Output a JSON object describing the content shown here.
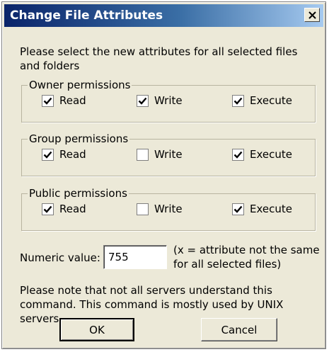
{
  "window": {
    "title": "Change File Attributes",
    "close_glyph": "✕"
  },
  "intro_text": "Please select the new attributes for all selected files and folders",
  "groups": [
    {
      "legend": "Owner permissions",
      "options": [
        {
          "label": "Read",
          "checked": true
        },
        {
          "label": "Write",
          "checked": true
        },
        {
          "label": "Execute",
          "checked": true
        }
      ]
    },
    {
      "legend": "Group permissions",
      "options": [
        {
          "label": "Read",
          "checked": true
        },
        {
          "label": "Write",
          "checked": false
        },
        {
          "label": "Execute",
          "checked": true
        }
      ]
    },
    {
      "legend": "Public permissions",
      "options": [
        {
          "label": "Read",
          "checked": true
        },
        {
          "label": "Write",
          "checked": false
        },
        {
          "label": "Execute",
          "checked": true
        }
      ]
    }
  ],
  "numeric": {
    "label": "Numeric value:",
    "value": "755",
    "hint": "(x = attribute not the same for all selected files)"
  },
  "note": "Please note that not all servers understand this command. This command is mostly used by UNIX servers.",
  "buttons": {
    "ok": "OK",
    "cancel": "Cancel"
  }
}
